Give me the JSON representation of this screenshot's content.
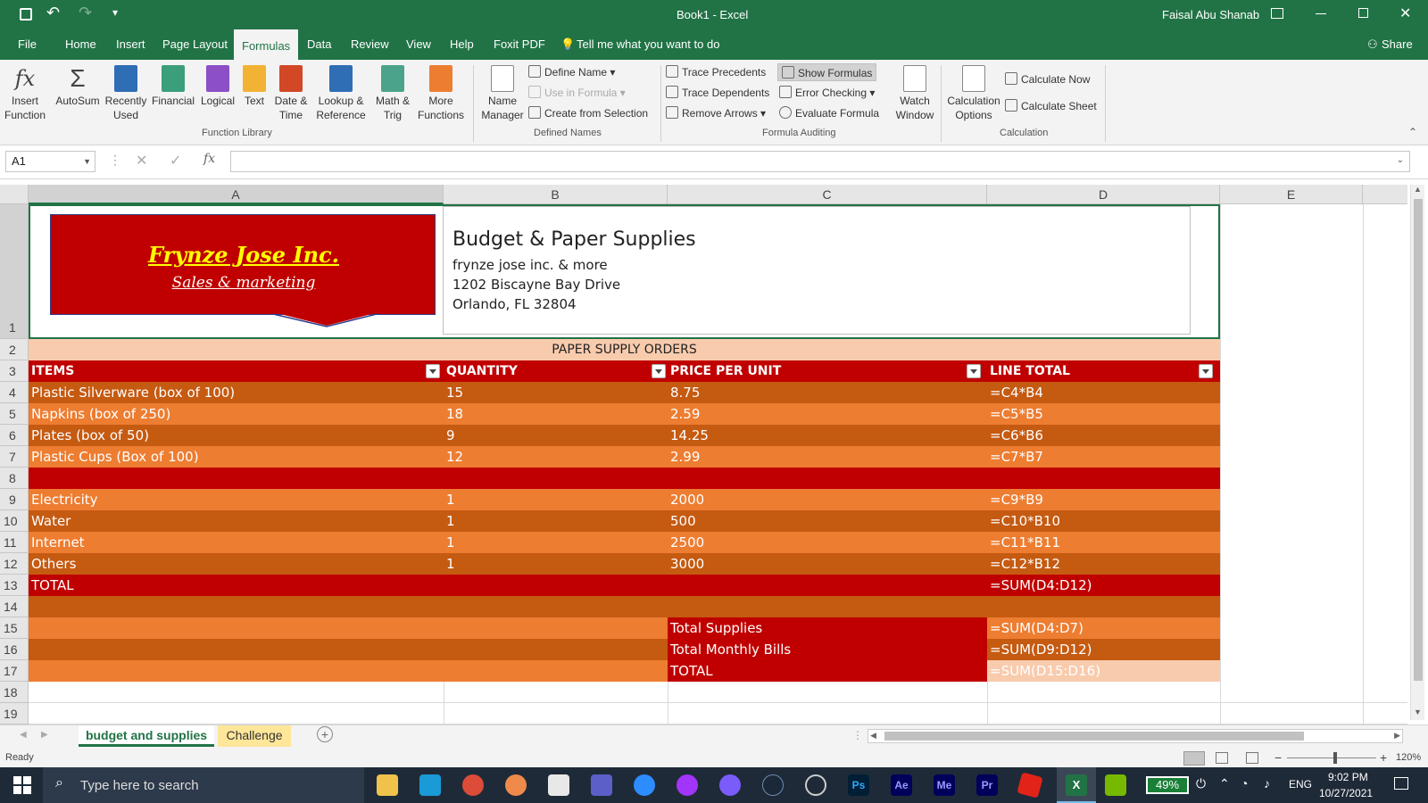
{
  "titlebar": {
    "doc_title": "Book1  -  Excel",
    "user": "Faisal Abu Shanab"
  },
  "tabs": [
    "File",
    "Home",
    "Insert",
    "Page Layout",
    "Formulas",
    "Data",
    "Review",
    "View",
    "Help",
    "Foxit PDF"
  ],
  "tell_me": "Tell me what you want to do",
  "share": "Share",
  "ribbon": {
    "insert_function": "Insert\nFunction",
    "autosum": "AutoSum",
    "recently_used": "Recently\nUsed",
    "financial": "Financial",
    "logical": "Logical",
    "text": "Text",
    "date_time": "Date &\nTime",
    "lookup": "Lookup &\nReference",
    "math": "Math &\nTrig",
    "more": "More\nFunctions",
    "group_function_library": "Function Library",
    "name_manager": "Name\nManager",
    "define_name": "Define Name",
    "use_in_formula": "Use in Formula",
    "create_from_selection": "Create from Selection",
    "group_defined_names": "Defined Names",
    "trace_precedents": "Trace Precedents",
    "trace_dependents": "Trace Dependents",
    "remove_arrows": "Remove Arrows",
    "show_formulas": "Show Formulas",
    "error_checking": "Error Checking",
    "evaluate_formula": "Evaluate Formula",
    "watch_window": "Watch\nWindow",
    "group_formula_auditing": "Formula Auditing",
    "calc_options": "Calculation\nOptions",
    "calculate_now": "Calculate Now",
    "calculate_sheet": "Calculate Sheet",
    "group_calculation": "Calculation"
  },
  "formula_bar": {
    "name_box": "A1",
    "fx": "fx",
    "formula": ""
  },
  "columns": [
    "A",
    "B",
    "C",
    "D",
    "E"
  ],
  "rows": [
    "1",
    "2",
    "3",
    "4",
    "5",
    "6",
    "7",
    "8",
    "9",
    "10",
    "11",
    "12",
    "13",
    "14",
    "15",
    "16",
    "17",
    "18",
    "19"
  ],
  "header": {
    "logo_line1": "Frynze Jose Inc.",
    "logo_line2": "Sales & marketing",
    "title": "Budget & Paper Supplies",
    "line1": "frynze jose inc. & more",
    "line2": "1202 Biscayne Bay Drive",
    "line3": "Orlando, FL 32804"
  },
  "section_title": "PAPER SUPPLY ORDERS",
  "table_headers": [
    "ITEMS",
    "QUANTITY",
    "PRICE PER UNIT",
    "LINE TOTAL"
  ],
  "table_rows": [
    {
      "a": "Plastic Silverware (box of 100)",
      "b": "15",
      "c": "8.75",
      "d": "=C4*B4"
    },
    {
      "a": "Napkins (box of 250)",
      "b": "18",
      "c": "2.59",
      "d": "=C5*B5"
    },
    {
      "a": "Plates (box of 50)",
      "b": "9",
      "c": "14.25",
      "d": "=C6*B6"
    },
    {
      "a": "Plastic Cups (Box of 100)",
      "b": "12",
      "c": "2.99",
      "d": "=C7*B7"
    },
    {
      "a": "",
      "b": "",
      "c": "",
      "d": ""
    },
    {
      "a": "Electricity",
      "b": "1",
      "c": "2000",
      "d": "=C9*B9"
    },
    {
      "a": "Water",
      "b": "1",
      "c": "500",
      "d": "=C10*B10"
    },
    {
      "a": "Internet",
      "b": "1",
      "c": "2500",
      "d": "=C11*B11"
    },
    {
      "a": "Others",
      "b": "1",
      "c": "3000",
      "d": "=C12*B12"
    },
    {
      "a": "TOTAL",
      "b": "",
      "c": "",
      "d": "=SUM(D4:D12)"
    }
  ],
  "summary": [
    {
      "label": "Total Supplies",
      "value": "=SUM(D4:D7)"
    },
    {
      "label": "Total Monthly Bills",
      "value": "=SUM(D9:D12)"
    },
    {
      "label": "TOTAL",
      "value": "=SUM(D15:D16)"
    }
  ],
  "sheets": [
    "budget and supplies",
    "Challenge"
  ],
  "status": {
    "ready": "Ready",
    "zoom": "120%"
  },
  "taskbar": {
    "search": "Type here to search",
    "battery": "49%",
    "lang": "ENG",
    "time": "9:02 PM",
    "date": "10/27/2021"
  },
  "colors": {
    "excel_green": "#217346",
    "dark_red": "#c00000",
    "dark_orange": "#c55a11",
    "orange": "#ed7d31",
    "peach": "#f8cbad"
  }
}
